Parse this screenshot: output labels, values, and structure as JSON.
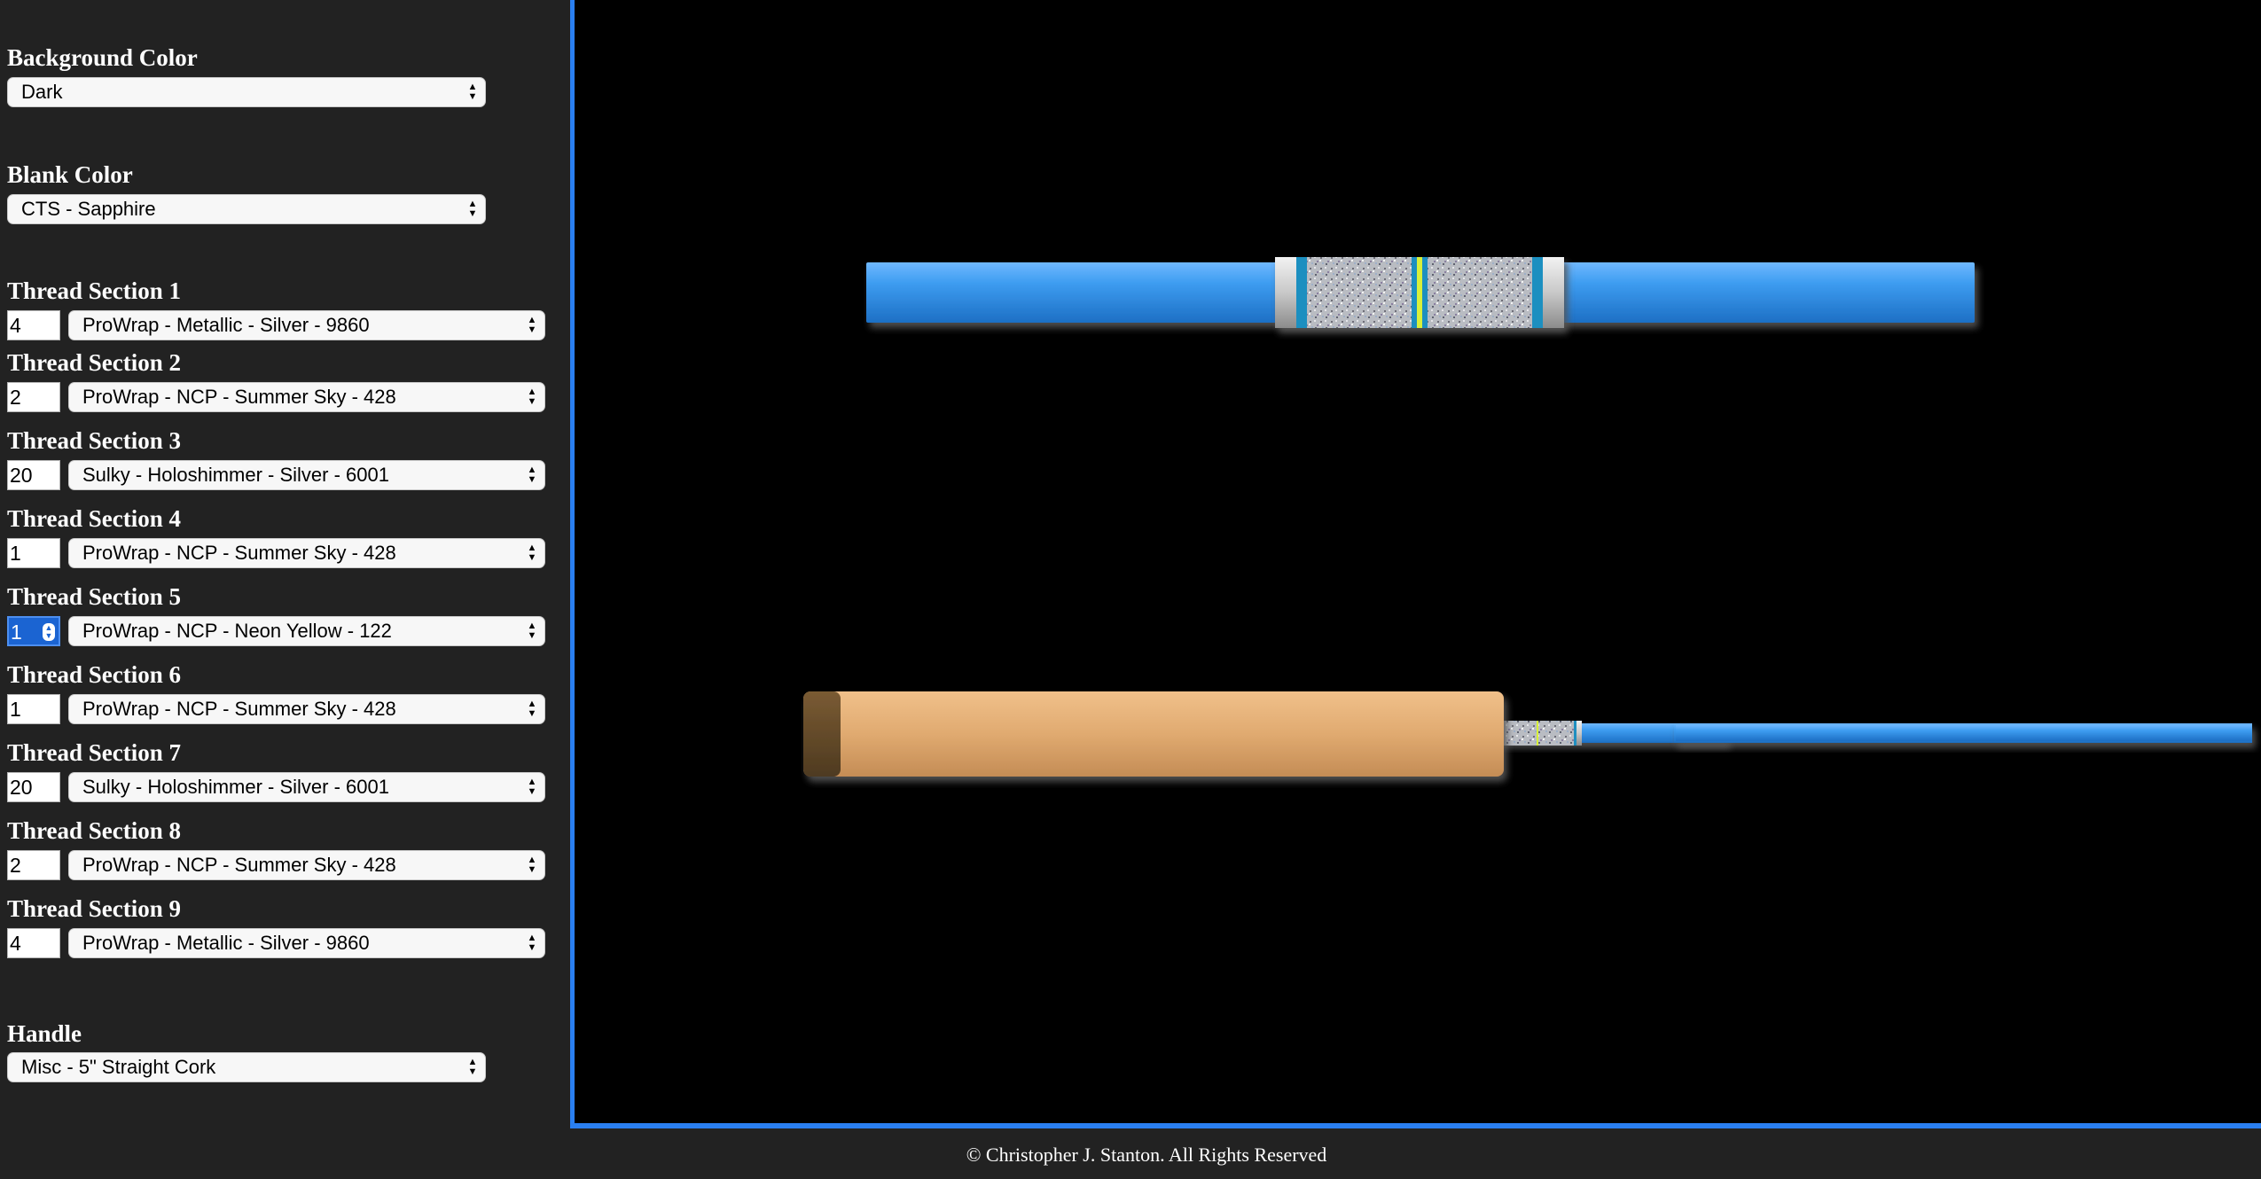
{
  "controls": {
    "background_color": {
      "label": "Background Color",
      "value": "Dark"
    },
    "blank_color": {
      "label": "Blank Color",
      "value": "CTS - Sapphire"
    },
    "thread_sections": [
      {
        "label": "Thread Section 1",
        "count": "4",
        "thread": "ProWrap - Metallic - Silver - 9860"
      },
      {
        "label": "Thread Section 2",
        "count": "2",
        "thread": "ProWrap - NCP - Summer Sky - 428"
      },
      {
        "label": "Thread Section 3",
        "count": "20",
        "thread": "Sulky - Holoshimmer - Silver - 6001"
      },
      {
        "label": "Thread Section 4",
        "count": "1",
        "thread": "ProWrap - NCP - Summer Sky - 428"
      },
      {
        "label": "Thread Section 5",
        "count": "1",
        "thread": "ProWrap - NCP - Neon Yellow - 122"
      },
      {
        "label": "Thread Section 6",
        "count": "1",
        "thread": "ProWrap - NCP - Summer Sky - 428"
      },
      {
        "label": "Thread Section 7",
        "count": "20",
        "thread": "Sulky - Holoshimmer - Silver - 6001"
      },
      {
        "label": "Thread Section 8",
        "count": "2",
        "thread": "ProWrap - NCP - Summer Sky - 428"
      },
      {
        "label": "Thread Section 9",
        "count": "4",
        "thread": "ProWrap - Metallic - Silver - 9860"
      }
    ],
    "handle": {
      "label": "Handle",
      "value": "Misc - 5\" Straight Cork"
    }
  },
  "footer": {
    "copyright": "© Christopher J. Stanton. All Rights Reserved"
  },
  "colors": {
    "sidebar_bg": "#222222",
    "canvas_bg": "#000000",
    "accent_border": "#2a7ff0",
    "blank_blue": "#3d9cf0",
    "summer_sky": "#1f8fc0",
    "neon_yellow": "#d8f03a",
    "cork": "#e2ad72"
  },
  "icons": {
    "select_arrows": "up-down-arrows-icon",
    "number_spinner": "spinner-icon"
  }
}
